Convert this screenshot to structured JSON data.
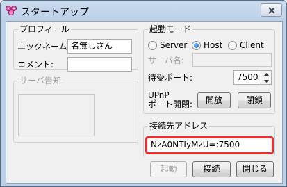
{
  "window": {
    "title": "スタートアップ"
  },
  "profile": {
    "legend": "プロフィール",
    "nickname_label": "ニックネーム:",
    "nickname_value": "名無しさん",
    "comment_label": "コメント:",
    "comment_value": ""
  },
  "server_notice": {
    "legend": "サーバ告知"
  },
  "mode": {
    "legend": "起動モード",
    "options": [
      "Server",
      "Host",
      "Client"
    ],
    "selected": "Host",
    "server_name_label": "サーバ名:",
    "server_name_value": "",
    "port_label": "待受ポート:",
    "port_value": "7500",
    "upnp_label_1": "UPnP",
    "upnp_label_2": "ポート開閉:",
    "open_button": "開放",
    "close_button": "閉鎖"
  },
  "address": {
    "legend": "接続先アドレス",
    "value": "NzA0NTIyMzU=:7500",
    "highlight_color": "#ee2d2d"
  },
  "buttons": {
    "start": "起動",
    "connect": "接続",
    "close": "閉じる"
  }
}
